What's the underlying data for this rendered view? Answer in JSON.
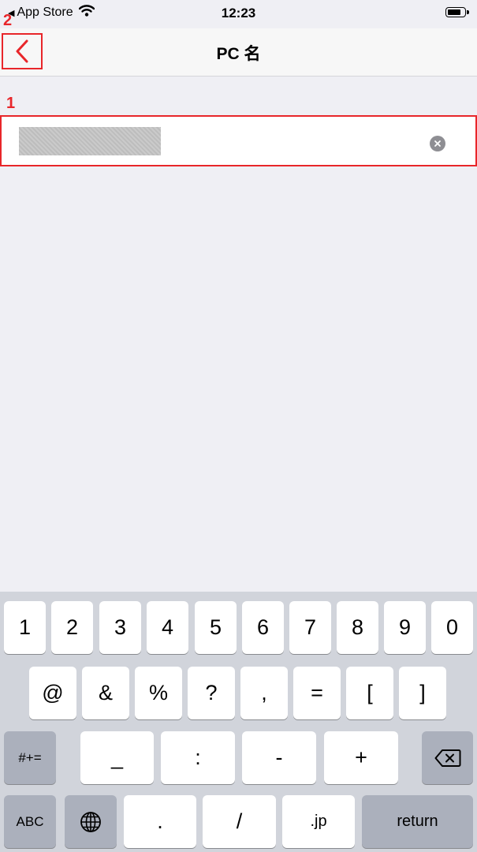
{
  "status_bar": {
    "carrier_back": "App Store",
    "time": "12:23",
    "battery_level": 0.85
  },
  "nav": {
    "title": "PC 名"
  },
  "annotations": {
    "back": "2",
    "field": "1"
  },
  "field": {
    "value": ""
  },
  "keyboard": {
    "row1": [
      "1",
      "2",
      "3",
      "4",
      "5",
      "6",
      "7",
      "8",
      "9",
      "0"
    ],
    "row2": [
      "@",
      "&",
      "%",
      "?",
      ",",
      "=",
      "[",
      "]"
    ],
    "row3": {
      "shift": "#+=",
      "keys": [
        "_",
        ":",
        "-",
        "+"
      ]
    },
    "row4": {
      "abc": "ABC",
      "keys": [
        ".",
        "/",
        ".jp"
      ],
      "return": "return"
    }
  },
  "colors": {
    "annotation": "#e8262a",
    "background": "#efeff4",
    "keyboard": "#d1d4db"
  }
}
